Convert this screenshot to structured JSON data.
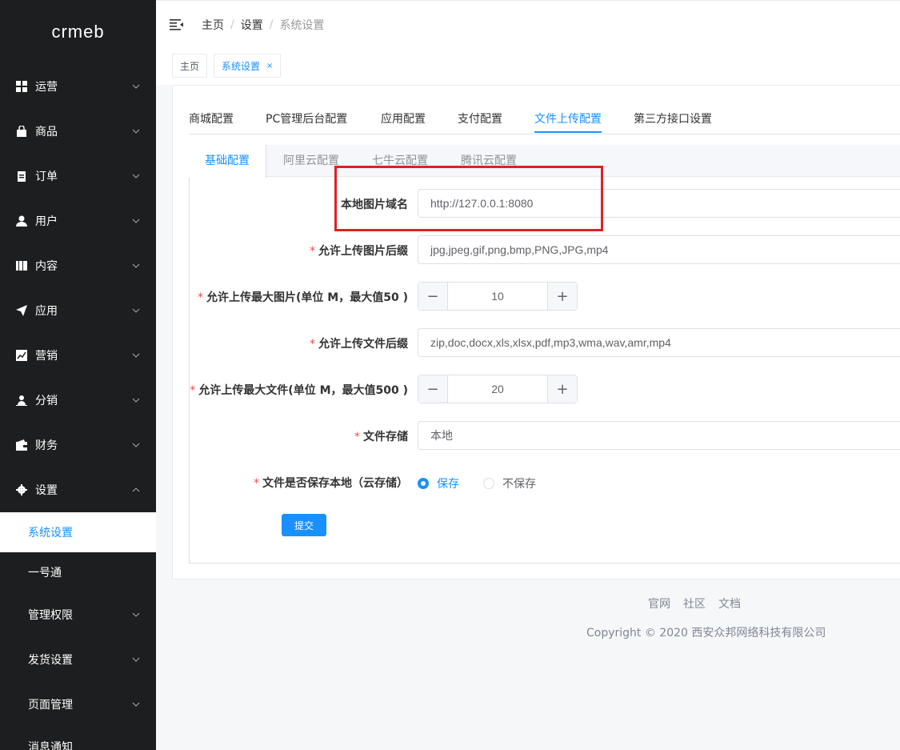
{
  "sidebar": {
    "logo": "crmeb",
    "menu": [
      {
        "label": "运营",
        "icon": "grid-icon",
        "expanded": false
      },
      {
        "label": "商品",
        "icon": "bag-icon",
        "expanded": false
      },
      {
        "label": "订单",
        "icon": "clipboard-icon",
        "expanded": false
      },
      {
        "label": "用户",
        "icon": "user-icon",
        "expanded": false
      },
      {
        "label": "内容",
        "icon": "book-icon",
        "expanded": false
      },
      {
        "label": "应用",
        "icon": "send-icon",
        "expanded": false
      },
      {
        "label": "营销",
        "icon": "chart-icon",
        "expanded": false
      },
      {
        "label": "分销",
        "icon": "person-icon",
        "expanded": false
      },
      {
        "label": "财务",
        "icon": "wallet-icon",
        "expanded": false
      },
      {
        "label": "设置",
        "icon": "gear-icon",
        "expanded": true
      }
    ],
    "submenu": [
      {
        "label": "系统设置",
        "active": true,
        "has_children": false
      },
      {
        "label": "一号通",
        "active": false,
        "has_children": false
      },
      {
        "label": "管理权限",
        "active": false,
        "has_children": true
      },
      {
        "label": "发货设置",
        "active": false,
        "has_children": true
      },
      {
        "label": "页面管理",
        "active": false,
        "has_children": true
      },
      {
        "label": "消息通知",
        "active": false,
        "has_children": false
      }
    ]
  },
  "breadcrumb": [
    "主页",
    "设置",
    "系统设置"
  ],
  "tags": [
    {
      "label": "主页",
      "active": false
    },
    {
      "label": "系统设置",
      "active": true,
      "close": "×"
    }
  ],
  "tabs": [
    "商城配置",
    "PC管理后台配置",
    "应用配置",
    "支付配置",
    "文件上传配置",
    "第三方接口设置"
  ],
  "active_tab": "文件上传配置",
  "subtabs": [
    "基础配置",
    "阿里云配置",
    "七牛云配置",
    "腾讯云配置"
  ],
  "form": {
    "local_domain": {
      "label": "本地图片域名",
      "value": "http://127.0.0.1:8080"
    },
    "image_ext": {
      "label": "允许上传图片后缀",
      "value": "jpg,jpeg,gif,png,bmp,PNG,JPG,mp4"
    },
    "image_max": {
      "label": "允许上传最大图片(单位 M，最大值50 )",
      "value": "10",
      "minus": "−",
      "plus": "+"
    },
    "file_ext": {
      "label": "允许上传文件后缀",
      "value": "zip,doc,docx,xls,xlsx,pdf,mp3,wma,wav,amr,mp4"
    },
    "file_max": {
      "label": "允许上传最大文件(单位 M，最大值500 )",
      "value": "20",
      "minus": "−",
      "plus": "+"
    },
    "storage": {
      "label": "文件存储",
      "value": "本地"
    },
    "save_local": {
      "label": "文件是否保存本地（云存储）",
      "options": [
        "保存",
        "不保存"
      ],
      "selected": "保存"
    },
    "required_mark": "*",
    "submit_label": "提交"
  },
  "footer": {
    "links": [
      "官网",
      "社区",
      "文档"
    ],
    "copyright": "Copyright © 2020 西安众邦网络科技有限公司"
  },
  "colors": {
    "sidebar_bg": "#1d1e1f",
    "accent": "#1890ff",
    "highlight_box": "#e02020",
    "required": "#ff4949"
  }
}
